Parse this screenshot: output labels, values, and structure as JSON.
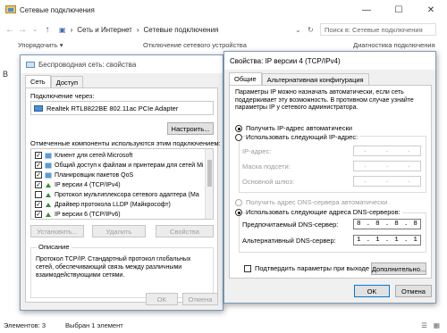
{
  "explorer": {
    "title": "Сетевые подключения",
    "breadcrumb": [
      "Сеть и Интернет",
      "Сетевые подключения"
    ],
    "search_placeholder": "Поиск в: Сетевые подключения",
    "cmd_left": "Упорядочить ▾",
    "cmd_mid": "Отключение сетевого устройства",
    "cmd_right": "Диагностика подключения",
    "status_items": "Элементов: 3",
    "status_selected": "Выбран 1 элемент",
    "side_letter": "В"
  },
  "left_dialog": {
    "title": "Беспроводная сеть: свойства",
    "tabs": [
      "Сеть",
      "Доступ"
    ],
    "connect_using_label": "Подключение через:",
    "adapter": "Realtek RTL8822BE 802.11ac PCIe Adapter",
    "configure_button": "Настроить...",
    "components_label": "Отмеченные компоненты используются этим подключением:",
    "components": [
      {
        "label": "Клиент для сетей Microsoft",
        "checked": true,
        "icon": "network-client-icon"
      },
      {
        "label": "Общий доступ к файлам и принтерам для сетей Mi",
        "checked": true,
        "icon": "file-share-icon"
      },
      {
        "label": "Планировщик пакетов QoS",
        "checked": true,
        "icon": "qos-icon"
      },
      {
        "label": "IP версии 4 (TCP/IPv4)",
        "checked": true,
        "icon": "protocol-icon"
      },
      {
        "label": "Протокол мультиплексора сетевого адаптера (Ма",
        "checked": false,
        "icon": "protocol-icon"
      },
      {
        "label": "Драйвер протокола LLDP (Майкрософт)",
        "checked": true,
        "icon": "protocol-icon"
      },
      {
        "label": "IP версии 6 (TCP/IPv6)",
        "checked": true,
        "icon": "protocol-icon"
      }
    ],
    "install_button": "Установить...",
    "remove_button": "Удалить",
    "properties_button": "Свойства",
    "description_title": "Описание",
    "description_text": "Протокол TCP/IP. Стандартный протокол глобальных сетей, обеспечивающий связь между различными взаимодействующими сетями.",
    "ok_button": "OK",
    "cancel_button": "Отмена"
  },
  "right_dialog": {
    "title": "Свойства: IP версии 4 (TCP/IPv4)",
    "tabs": [
      "Общие",
      "Альтернативная конфигурация"
    ],
    "intro": "Параметры IP можно назначать автоматически, если сеть поддерживает эту возможность. В противном случае узнайте параметры IP у сетевого администратора.",
    "ip_auto": "Получить IP-адрес автоматически",
    "ip_manual": "Использовать следующий IP-адрес:",
    "ip_address_label": "IP-адрес:",
    "mask_label": "Маска подсети:",
    "gateway_label": "Основной шлюз:",
    "dns_auto": "Получить адрес DNS-сервера автоматически",
    "dns_manual": "Использовать следующие адреса DNS-серверов:",
    "preferred_dns_label": "Предпочитаемый DNS-сервер:",
    "alternate_dns_label": "Альтернативный DNS-сервер:",
    "preferred_dns": [
      "8",
      "8",
      "8",
      "8"
    ],
    "alternate_dns": [
      "1",
      "1",
      "1",
      "1"
    ],
    "empty_octets": [
      ".",
      ".",
      "."
    ],
    "validate_label": "Подтвердить параметры при выходе",
    "advanced_button": "Дополнительно...",
    "ok_button": "OK",
    "cancel_button": "Отмена",
    "ip_mode": "auto",
    "dns_mode": "manual"
  }
}
